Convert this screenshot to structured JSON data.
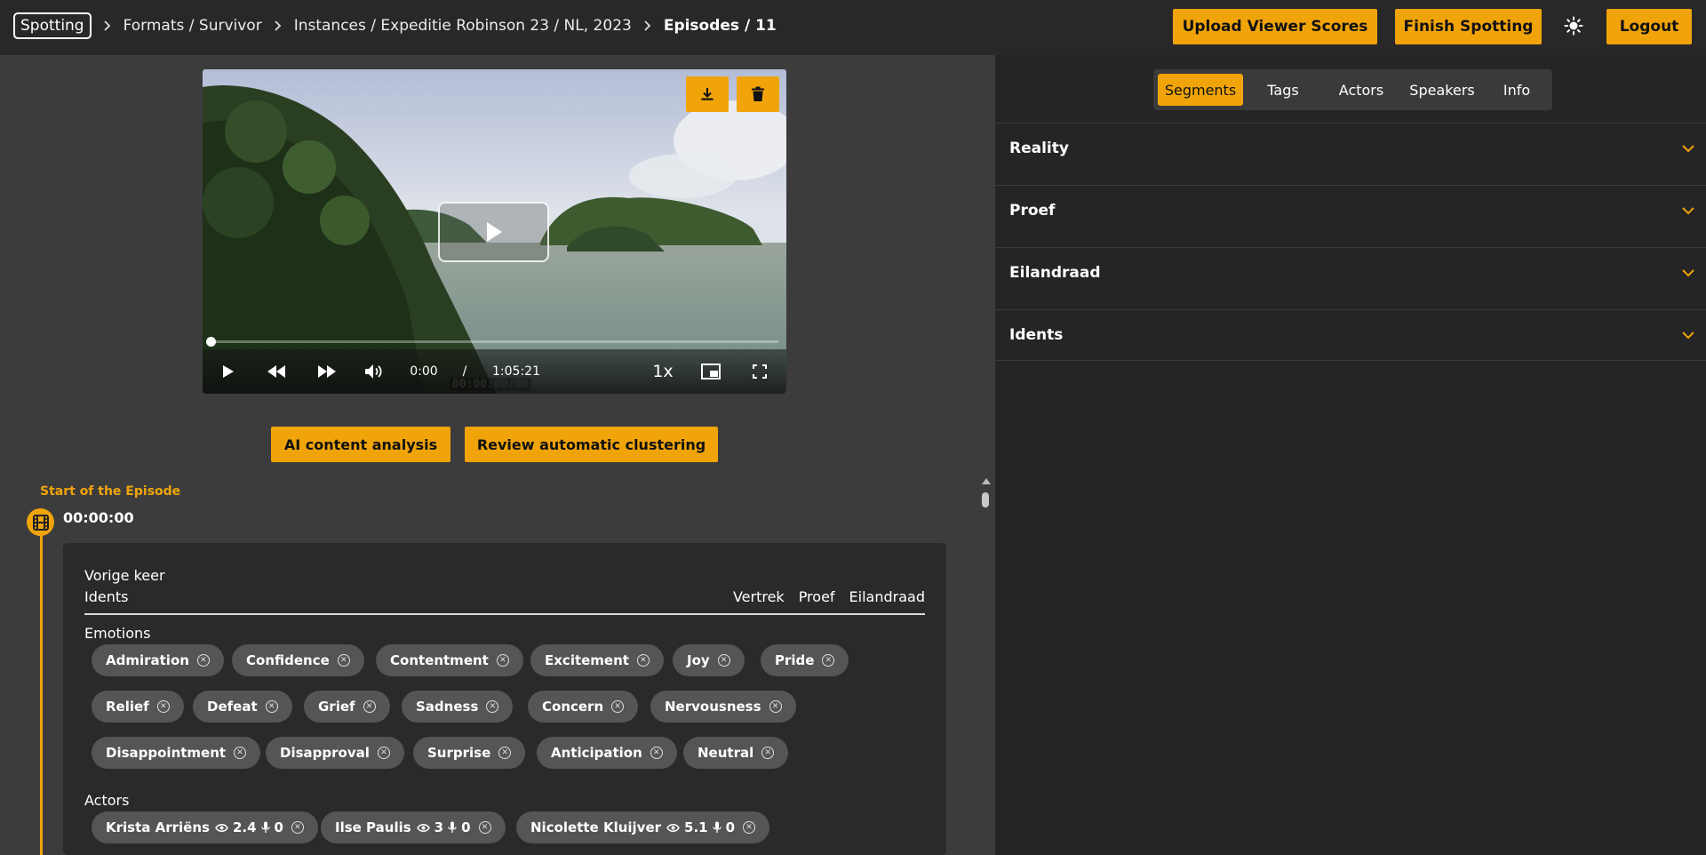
{
  "breadcrumb": {
    "home": "Spotting",
    "items": [
      "Formats / Survivor",
      "Instances / Expeditie Robinson 23 / NL, 2023"
    ],
    "current": "Episodes / 11"
  },
  "header": {
    "upload_label": "Upload Viewer Scores",
    "finish_label": "Finish Spotting",
    "logout_label": "Logout",
    "theme_icon": "sun-icon"
  },
  "player": {
    "current_time": "0:00",
    "separator": "/",
    "duration": "1:05:21",
    "speed": "1x",
    "timecode_overlay": "00:00:00:00",
    "progress": 0
  },
  "actions": {
    "ai_analysis": "AI content analysis",
    "review_clustering": "Review automatic clustering"
  },
  "timeline": {
    "start_label": "Start of the Episode",
    "start_time": "00:00:00"
  },
  "segment_card": {
    "title": "Vorige keer",
    "current_segment": "Idents",
    "segment_links": [
      "Vertrek",
      "Proef",
      "Eilandraad"
    ],
    "emotions_label": "Emotions",
    "emotions": [
      "Admiration",
      "Confidence",
      "Contentment",
      "Excitement",
      "Joy",
      "Pride",
      "Relief",
      "Defeat",
      "Grief",
      "Sadness",
      "Concern",
      "Nervousness",
      "Disappointment",
      "Disapproval",
      "Surprise",
      "Anticipation",
      "Neutral"
    ],
    "actors_label": "Actors",
    "actors": [
      {
        "name": "Krista Arriëns",
        "views": "2.4",
        "speaks": "0"
      },
      {
        "name": "Ilse Paulis",
        "views": "3",
        "speaks": "0"
      },
      {
        "name": "Nicolette Kluijver",
        "views": "5.1",
        "speaks": "0"
      }
    ]
  },
  "sidebar": {
    "tabs": [
      "Segments",
      "Tags",
      "Actors",
      "Speakers",
      "Info"
    ],
    "active_tab": "Segments",
    "sections": [
      "Reality",
      "Proef",
      "Eilandraad",
      "Idents"
    ]
  },
  "colors": {
    "accent": "#f0a40a",
    "background": "#3c3c3c",
    "panel": "#252525",
    "chip": "#555555"
  }
}
